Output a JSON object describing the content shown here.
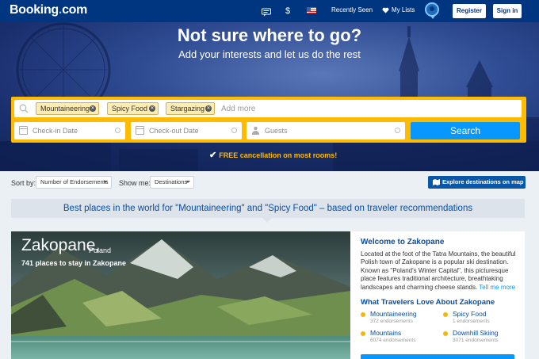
{
  "header": {
    "logo_main": "Booking",
    "logo_dot": ".",
    "logo_suffix": "com",
    "currency_symbol": "$",
    "recently_seen": "Recently Seen",
    "my_lists": "My Lists",
    "register": "Register",
    "sign_in": "Sign in",
    "icons": [
      "chat-icon",
      "flag-us-icon",
      "heart-icon",
      "genius-icon"
    ]
  },
  "hero": {
    "title": "Not sure where to go?",
    "subtitle": "Add your interests and let us do the rest",
    "chips": [
      "Mountaineering",
      "Spicy Food",
      "Stargazing"
    ],
    "chip_remove_glyph": "✕",
    "add_more_placeholder": "Add more",
    "checkin_placeholder": "Check-in Date",
    "checkout_placeholder": "Check-out Date",
    "guests_placeholder": "Guests",
    "search_label": "Search",
    "free_cancellation": "FREE cancellation on most rooms!",
    "check_glyph": "✔"
  },
  "sort": {
    "sort_by_label": "Sort by:",
    "sort_by_value": "Number of Endorsements",
    "show_me_label": "Show me:",
    "show_me_value": "Destinations",
    "map_button": "Explore destinations on map"
  },
  "banner": {
    "text": "Best places in the world for \"Mountaineering\" and \"Spicy Food\" – based on traveler recommendations"
  },
  "destination": {
    "name": "Zakopane,",
    "country": "Poland",
    "places": "741 places to stay in Zakopane",
    "welcome_title": "Welcome to Zakopane",
    "description": "Located at the foot of the Tatra Mountains, the beautiful Polish town of Zakopane is a popular ski destination. Known as \"Poland's Winter Capital\", this picturesque place features traditional architecture, breathtaking landscapes and charming cheese stands.",
    "tell_more": "Tell me more",
    "love_title": "What Travelers Love About Zakopane",
    "loves": [
      {
        "name": "Mountaineering",
        "endorsements": "372 endorsements"
      },
      {
        "name": "Spicy Food",
        "endorsements": "1 endorsements"
      },
      {
        "name": "Mountains",
        "endorsements": "6074 endorsements"
      },
      {
        "name": "Downhill Skiing",
        "endorsements": "3071 endorsements"
      }
    ]
  },
  "colors": {
    "brand_blue": "#003580",
    "accent_yellow": "#febb02",
    "action_blue": "#0896ff",
    "link_blue": "#0a4ea3"
  }
}
